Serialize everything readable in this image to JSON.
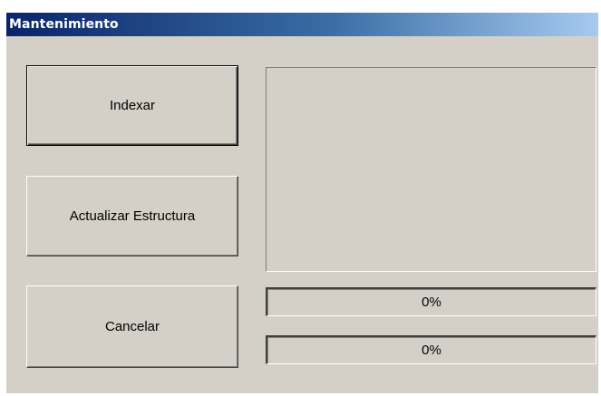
{
  "window": {
    "title": "Mantenimiento"
  },
  "buttons": {
    "indexar": "Indexar",
    "actualizar": "Actualizar Estructura",
    "cancelar": "Cancelar"
  },
  "progress": [
    {
      "label": "0%",
      "value": 0
    },
    {
      "label": "0%",
      "value": 0
    }
  ],
  "colors": {
    "face": "#d4d0c8",
    "title_start": "#0a246a",
    "title_end": "#a6caf0"
  }
}
